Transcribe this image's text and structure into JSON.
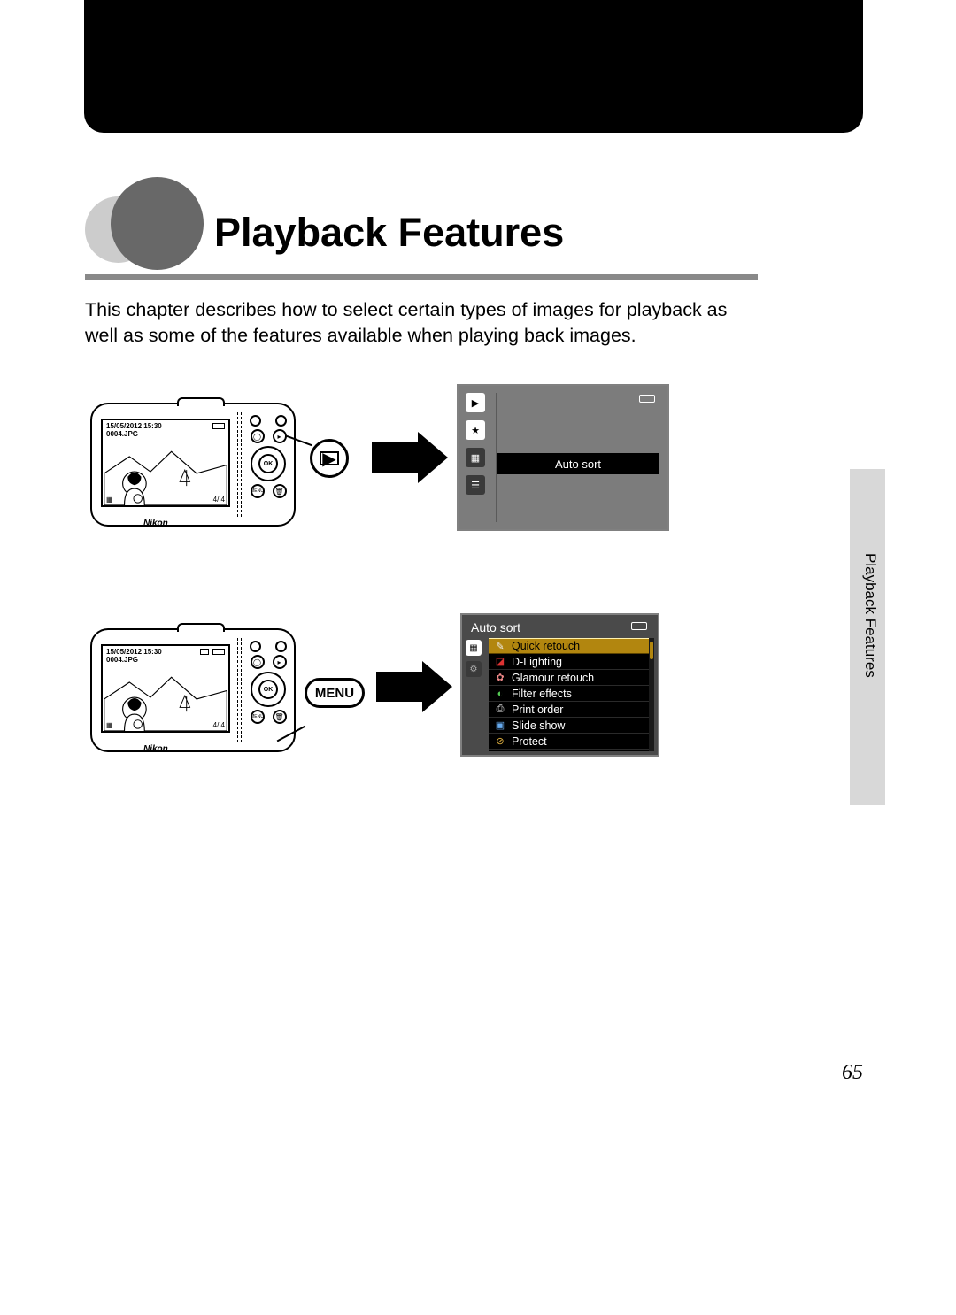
{
  "chapter": {
    "title": "Playback Features",
    "intro": "This chapter describes how to select certain types of images for playback as well as some of the features available when playing back images."
  },
  "side_tab_label": "Playback Features",
  "page_number": "65",
  "camera_overlay": {
    "date_line1": "15/05/2012 15:30",
    "file": "0004.JPG",
    "counter_left": "4/",
    "counter_right": "4",
    "logo": "Nikon"
  },
  "callout_labels": {
    "play_icon": "▶",
    "menu": "MENU"
  },
  "lcd1": {
    "highlight_label": "Auto sort",
    "tabs": [
      "▶",
      "★",
      "▦",
      "☰"
    ]
  },
  "lcd2": {
    "title": "Auto sort",
    "side_tabs": [
      "▦",
      "⚙"
    ],
    "items": [
      {
        "icon": "✎",
        "label": "Quick retouch",
        "cls": "wht"
      },
      {
        "icon": "◪",
        "label": "D-Lighting",
        "cls": "red"
      },
      {
        "icon": "✿",
        "label": "Glamour retouch",
        "cls": "pnk"
      },
      {
        "icon": "◐",
        "label": "Filter effects",
        "cls": "grn"
      },
      {
        "icon": "⎙",
        "label": "Print order",
        "cls": "wht"
      },
      {
        "icon": "▣",
        "label": "Slide show",
        "cls": "blu"
      },
      {
        "icon": "⊘",
        "label": "Protect",
        "cls": "yel"
      }
    ]
  }
}
